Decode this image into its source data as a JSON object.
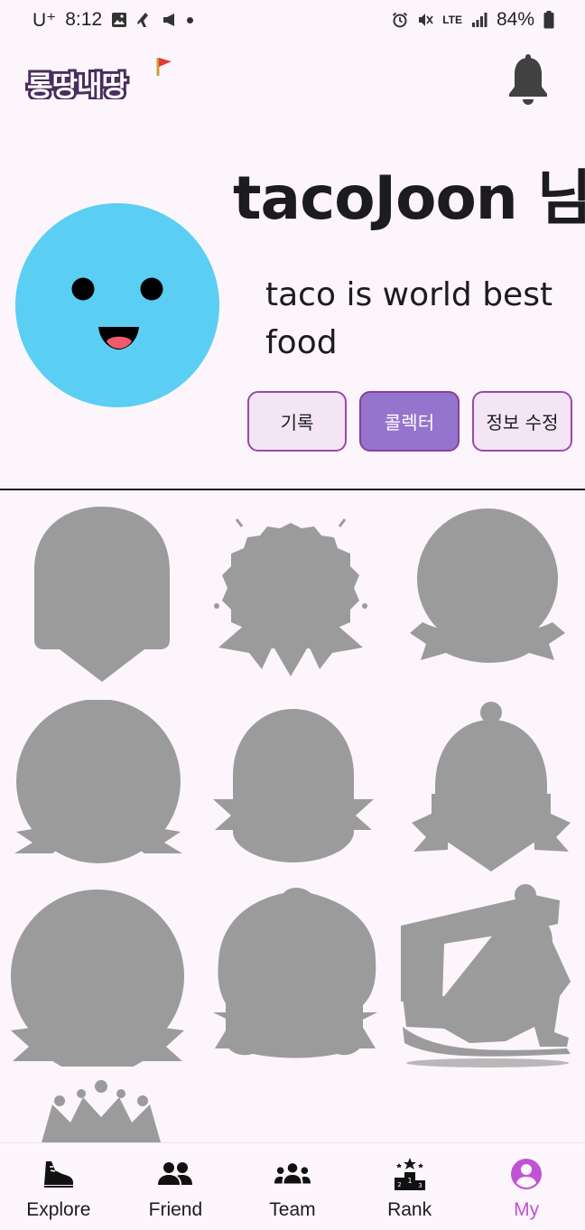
{
  "status_bar": {
    "carrier": "U⁺",
    "time": "8:12",
    "battery": "84%",
    "network": "LTE"
  },
  "app_bar": {
    "logo_text": "롱땅내땅",
    "logo_flag_color": "#e53935",
    "notifications_icon": "bell-icon"
  },
  "profile": {
    "username": "tacoJoon 님",
    "bio": "taco is world best food",
    "avatar_color": "#5bcef4",
    "buttons": [
      {
        "label": "기록",
        "active": false
      },
      {
        "label": "콜렉터",
        "active": true
      },
      {
        "label": "정보 수정",
        "active": false
      }
    ]
  },
  "badges": {
    "locked_color": "#9b9b9b",
    "items": [
      {
        "shape": "shield-badge",
        "locked": true
      },
      {
        "shape": "rosette-badge",
        "locked": true
      },
      {
        "shape": "ribbon-circle-badge",
        "locked": true
      },
      {
        "shape": "circle-banner-badge",
        "locked": true
      },
      {
        "shape": "dome-banner-badge",
        "locked": true
      },
      {
        "shape": "bell-banner-badge",
        "locked": true
      },
      {
        "shape": "big-circle-banner-badge",
        "locked": true
      },
      {
        "shape": "blob-banner-badge",
        "locked": true
      },
      {
        "shape": "runner-badge",
        "locked": true
      },
      {
        "shape": "crown-badge",
        "locked": true
      }
    ]
  },
  "bottom_nav": {
    "items": [
      {
        "label": "Explore",
        "icon": "shoe-icon",
        "active": false
      },
      {
        "label": "Friend",
        "icon": "people-icon",
        "active": false
      },
      {
        "label": "Team",
        "icon": "groups-icon",
        "active": false
      },
      {
        "label": "Rank",
        "icon": "podium-icon",
        "active": false
      },
      {
        "label": "My",
        "icon": "account-icon",
        "active": true
      }
    ],
    "active_color": "#c052d6"
  }
}
